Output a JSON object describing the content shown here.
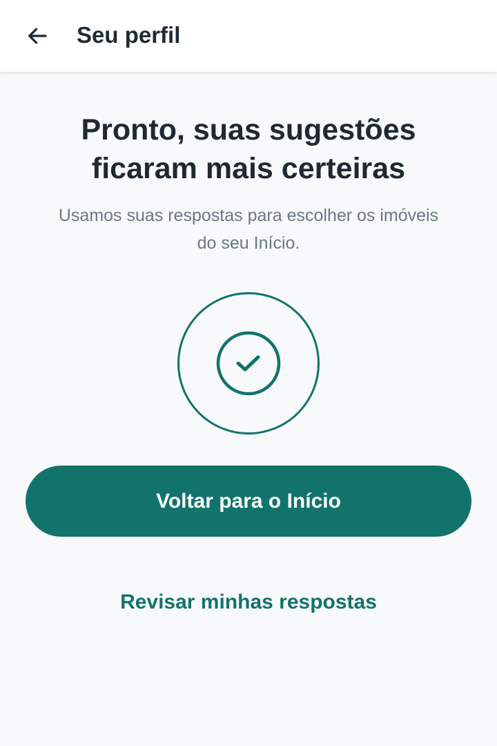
{
  "app_bar": {
    "back_icon": "arrow-left-icon",
    "title": "Seu perfil"
  },
  "content": {
    "headline_line1": "Pronto, suas sugestões",
    "headline_line2": "ficaram mais certeiras",
    "subtitle_line1": "Usamos suas respostas para escolher os imóveis",
    "subtitle_line2": "do seu Início.",
    "illustration_icon": "check-circle-icon"
  },
  "actions": {
    "primary_label": "Voltar para o Início",
    "secondary_label": "Revisar minhas respostas"
  },
  "colors": {
    "accent": "#12736b",
    "text_primary": "#1f2933",
    "text_secondary": "#6b7785",
    "background": "#f7f9fb",
    "app_bar": "#ffffff"
  }
}
